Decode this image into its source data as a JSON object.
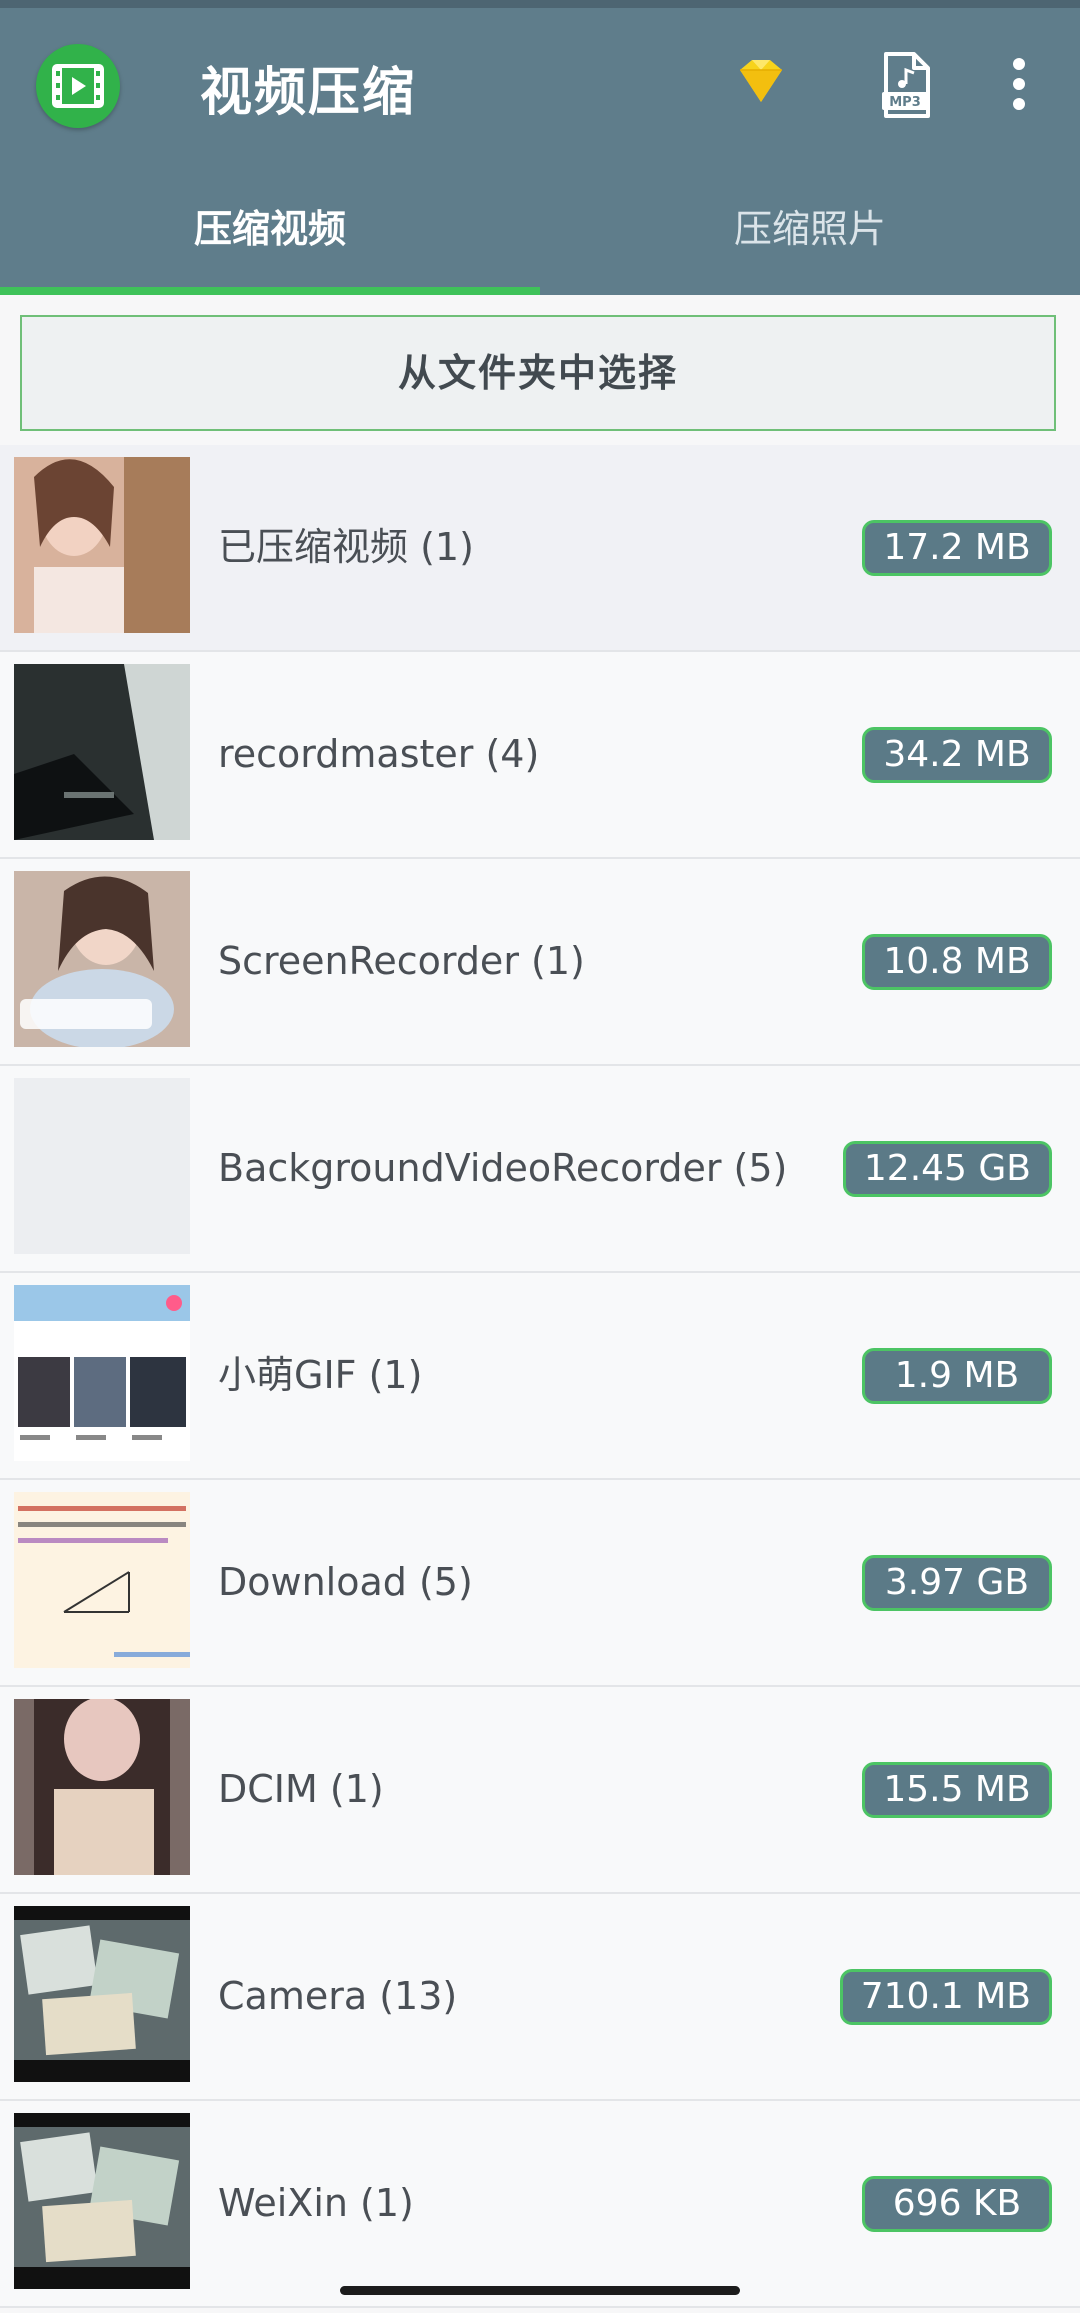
{
  "app": {
    "title": "视频压缩",
    "colors": {
      "toolbar": "#5f7d8b",
      "accent": "#3fc25a",
      "badge": "#5b7a87"
    }
  },
  "toolbar": {
    "logo_icon": "video-compress-logo-icon",
    "premium_icon": "diamond-icon",
    "mp3_icon": "mp3-file-icon",
    "more_icon": "more-vert-icon",
    "mp3_text": "MP3"
  },
  "tabs": [
    {
      "label": "压缩视频",
      "active": true
    },
    {
      "label": "压缩照片",
      "active": false
    }
  ],
  "folder_button": {
    "label": "从文件夹中选择"
  },
  "folders": [
    {
      "label": "已压缩视频 (1)",
      "size": "17.2 MB",
      "thumb": "portrait-photo"
    },
    {
      "label": "recordmaster (4)",
      "size": "34.2 MB",
      "thumb": "dark-video"
    },
    {
      "label": "ScreenRecorder (1)",
      "size": "10.8 MB",
      "thumb": "portrait-photo"
    },
    {
      "label": "BackgroundVideoRecorder (5)",
      "size": "12.45 GB",
      "thumb": "blank"
    },
    {
      "label": "小萌GIF (1)",
      "size": "1.9 MB",
      "thumb": "app-screenshot"
    },
    {
      "label": "Download (5)",
      "size": "3.97 GB",
      "thumb": "math-worksheet"
    },
    {
      "label": "DCIM (1)",
      "size": "15.5 MB",
      "thumb": "portrait-photo"
    },
    {
      "label": "Camera (13)",
      "size": "710.1 MB",
      "thumb": "cards-photo"
    },
    {
      "label": "WeiXin (1)",
      "size": "696 KB",
      "thumb": "cards-photo"
    }
  ]
}
